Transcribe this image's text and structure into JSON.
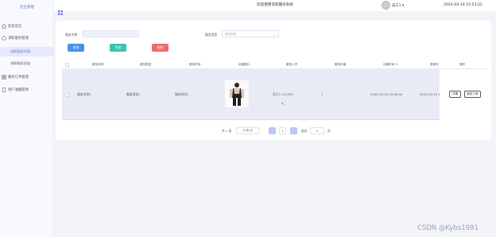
{
  "app": {
    "brand": "后台管理"
  },
  "topbar": {
    "title": "欢迎使用求职服务系统",
    "user": "员工1 ▾",
    "datetime": "2024-04-19 15:53:22"
  },
  "sidebar": {
    "items": [
      {
        "label": "后台首页"
      },
      {
        "label": "求职服务管理"
      },
      {
        "label": "求职服务列表",
        "active": true
      },
      {
        "label": "求职服务添加"
      },
      {
        "label": "服务订单管理"
      },
      {
        "label": "用户收藏管理"
      }
    ]
  },
  "filters": {
    "name_label": "服务名称",
    "name_value": "",
    "type_label": "服务类型",
    "type_placeholder": "服务类型",
    "search": "查询",
    "add": "添加",
    "delete": "删除"
  },
  "table": {
    "headers": [
      "服务名称",
      "服务类型",
      "服务时间",
      "封面图片",
      "服务人员",
      "服务价格",
      "创建时间 ↕",
      "更新时",
      "操作"
    ],
    "rows": [
      {
        "name": "服务名称1",
        "type": "服务类型1",
        "time": "服务时间1",
        "staff": "员工1-112233",
        "price": "1",
        "created": "2024-04-19 15:48:50",
        "updated": "2024-04-19 15"
      }
    ],
    "ops": {
      "detail": "详情",
      "orders": "服务订单"
    }
  },
  "pagination": {
    "total": "共 1 条",
    "per_page": "10条/页",
    "prev": "‹",
    "page": "1",
    "next": "›",
    "goto": "前往",
    "goto_value": "1",
    "page_unit": "页"
  },
  "watermark": "CSDN @Kybs1991",
  "colors": {
    "accent": "#6c74d8",
    "search": "#4a90f0",
    "add": "#3cc3b0",
    "delete": "#f06a6a"
  }
}
